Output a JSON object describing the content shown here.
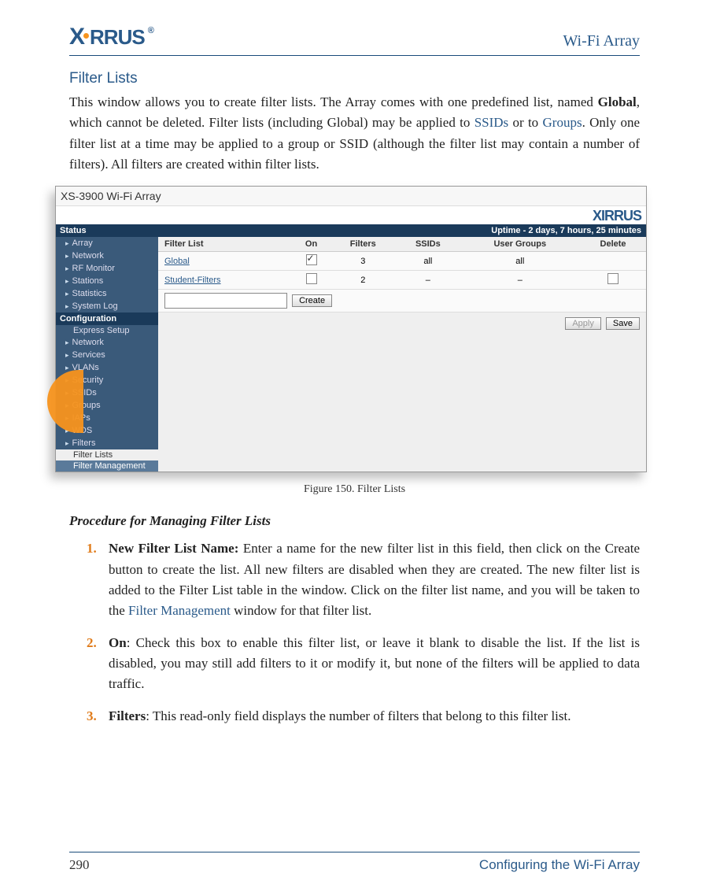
{
  "header": {
    "brand": "X•RRUS",
    "title": "Wi-Fi Array"
  },
  "section_title": "Filter Lists",
  "intro": {
    "t1": "This window allows you to create filter lists. The Array comes with one predefined list, named ",
    "bold1": "Global",
    "t2": ", which cannot be deleted. Filter lists (including Global) may be applied to ",
    "link1": "SSIDs",
    "t3": " or to ",
    "link2": "Groups",
    "t4": ". Only one filter list at a time may be applied to a group or SSID (although the filter list may contain a number of filters). All filters are created within filter lists."
  },
  "screenshot": {
    "window_title": "XS-3900 Wi-Fi Array",
    "brand": "XIRRUS",
    "uptime": "Uptime - 2 days, 7 hours, 25 minutes",
    "side": {
      "status_hdr": "Status",
      "status_items": [
        "Array",
        "Network",
        "RF Monitor",
        "Stations",
        "Statistics",
        "System Log"
      ],
      "config_hdr": "Configuration",
      "config_items": [
        "Express Setup",
        "Network",
        "Services",
        "VLANs",
        "Security",
        "SSIDs",
        "Groups",
        "IAPs",
        "WDS",
        "Filters"
      ],
      "sub_white": "Filter Lists",
      "sub_active": "Filter Management"
    },
    "table": {
      "headers": [
        "Filter List",
        "On",
        "Filters",
        "SSIDs",
        "User Groups",
        "Delete"
      ],
      "rows": [
        {
          "name": "Global",
          "on": true,
          "filters": "3",
          "ssids": "all",
          "groups": "all",
          "delete": ""
        },
        {
          "name": "Student-Filters",
          "on": false,
          "filters": "2",
          "ssids": "–",
          "groups": "–",
          "delete": "box"
        }
      ],
      "create_btn": "Create",
      "apply_btn": "Apply",
      "save_btn": "Save"
    }
  },
  "figure_caption": "Figure 150. Filter Lists",
  "procedure_title": "Procedure for Managing Filter Lists",
  "steps": [
    {
      "n": "1.",
      "bold": "New Filter List Name: ",
      "t1": "Enter a name for the new filter list in this field, then click on the Create button to create the list. All new filters are disabled when they are created. The new filter list is added to the Filter List table in the window. Click on the filter list name, and you will be taken to the ",
      "link": "Filter Management",
      "t2": " window for that filter list."
    },
    {
      "n": "2.",
      "bold": "On",
      "t1": ": Check this box to enable this filter list, or leave it blank to disable the list. If the list is disabled, you may still add filters to it or modify it, but none of the filters will be applied to data traffic.",
      "link": "",
      "t2": ""
    },
    {
      "n": "3.",
      "bold": "Filters",
      "t1": ": This read-only field displays the number of filters that belong to this filter list.",
      "link": "",
      "t2": ""
    }
  ],
  "footer": {
    "page": "290",
    "title": "Configuring the Wi-Fi Array"
  }
}
